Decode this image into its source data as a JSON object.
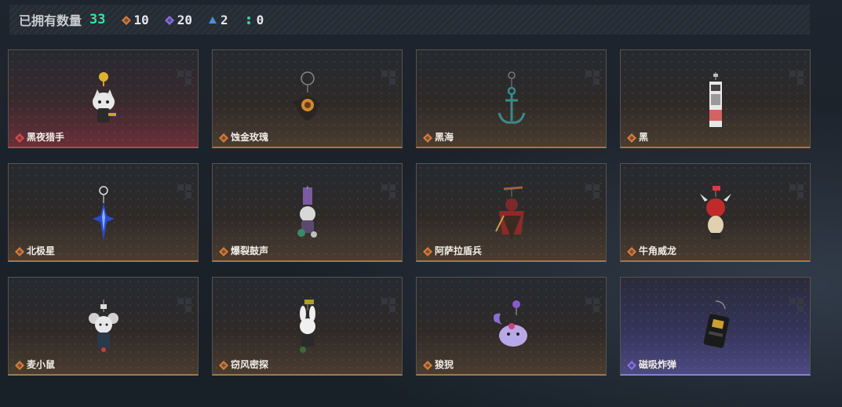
{
  "summary": {
    "label": "已拥有数量",
    "total": "33",
    "stats": [
      {
        "icon": "orange-gem-icon",
        "color": "#d87a3a",
        "value": "10"
      },
      {
        "icon": "purple-gem-icon",
        "color": "#8a6fe0",
        "value": "20"
      },
      {
        "icon": "blue-gem-icon",
        "color": "#4a8fd8",
        "value": "2"
      },
      {
        "icon": "green-dots-icon",
        "color": "#3ad0a0",
        "value": "0"
      }
    ]
  },
  "items": [
    {
      "name": "黑夜猎手",
      "rarity": "red",
      "gem_color": "#d84a4a",
      "charm": "cat-warrior-charm-icon"
    },
    {
      "name": "蚀金玫瑰",
      "rarity": "orange",
      "gem_color": "#d87a3a",
      "charm": "rose-orb-charm-icon"
    },
    {
      "name": "黑海",
      "rarity": "orange",
      "gem_color": "#d87a3a",
      "charm": "anchor-charm-icon"
    },
    {
      "name": "黑",
      "rarity": "orange",
      "gem_color": "#d87a3a",
      "charm": "tag-charm-icon"
    },
    {
      "name": "北极星",
      "rarity": "orange",
      "gem_color": "#d87a3a",
      "charm": "star-blade-charm-icon"
    },
    {
      "name": "爆裂鼓声",
      "rarity": "orange",
      "gem_color": "#d87a3a",
      "charm": "drummer-charm-icon"
    },
    {
      "name": "阿萨拉盾兵",
      "rarity": "orange",
      "gem_color": "#d87a3a",
      "charm": "shield-soldier-charm-icon"
    },
    {
      "name": "牛角威龙",
      "rarity": "orange",
      "gem_color": "#d87a3a",
      "charm": "horned-dragon-charm-icon"
    },
    {
      "name": "麦小鼠",
      "rarity": "orange",
      "gem_color": "#d87a3a",
      "charm": "mouse-charm-icon"
    },
    {
      "name": "窃风密探",
      "rarity": "orange",
      "gem_color": "#d87a3a",
      "charm": "rabbit-agent-charm-icon"
    },
    {
      "name": "狻猊",
      "rarity": "orange",
      "gem_color": "#d87a3a",
      "charm": "lion-beast-charm-icon"
    },
    {
      "name": "磁吸炸弹",
      "rarity": "purple",
      "gem_color": "#8a6fe0",
      "charm": "bomb-charm-icon"
    }
  ]
}
